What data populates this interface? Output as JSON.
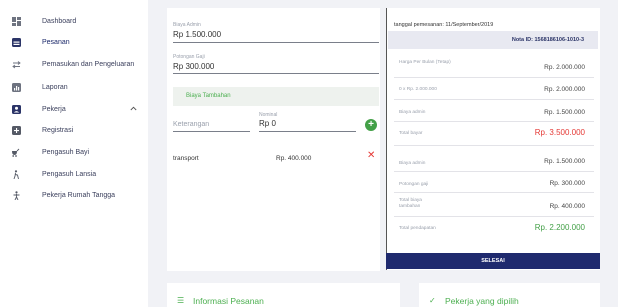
{
  "sidebar": {
    "items": [
      {
        "label": "Dashboard",
        "icon": "dashboard-icon"
      },
      {
        "label": "Pesanan",
        "icon": "orders-icon"
      },
      {
        "label": "Pemasukan dan Pengeluaran",
        "icon": "transfer-icon"
      },
      {
        "label": "Laporan",
        "icon": "report-icon"
      },
      {
        "label": "Pekerja",
        "icon": "worker-icon"
      },
      {
        "label": "Registrasi",
        "icon": "plus-box-icon"
      },
      {
        "label": "Pengasuh Bayi",
        "icon": "baby-icon"
      },
      {
        "label": "Pengasuh Lansia",
        "icon": "elderly-icon"
      },
      {
        "label": "Pekerja Rumah Tangga",
        "icon": "housekeeper-icon"
      }
    ]
  },
  "form": {
    "biaya_admin_label": "Biaya Admin",
    "biaya_admin_value": "Rp  1.500.000",
    "potongan_gaji_label": "Potongan Gaji",
    "potongan_gaji_value": "Rp  300.000",
    "biaya_tambahan_label": "Biaya Tambahan",
    "keterangan_placeholder": "Keterangan",
    "nominal_label": "Nominal",
    "nominal_value": "Rp  0",
    "rows": [
      {
        "keterangan": "transport",
        "nominal": "Rp. 400.000"
      }
    ]
  },
  "summary": {
    "tanggal": "tanggal pemesanan: 11/September/2019",
    "nota": "Nota ID: 1568186106-1010-3",
    "items": [
      {
        "label": "Harga Per Bulan (Tetap)",
        "value": "Rp. 2.000.000"
      },
      {
        "label": "0 x Rp. 2.000.000",
        "value": "Rp. 2.000.000"
      },
      {
        "label": "Biaya admin",
        "value": "Rp. 1.500.000"
      },
      {
        "label": "Total bayar",
        "value": "Rp. 3.500.000"
      },
      {
        "label": "Biaya admin",
        "value": "Rp. 1.500.000"
      },
      {
        "label": "Potongan gaji",
        "value": "Rp. 300.000"
      },
      {
        "label": "Total biaya tambahan",
        "value": "Rp. 400.000"
      },
      {
        "label": "Total pendapatan",
        "value": "Rp. 2.200.000"
      }
    ],
    "selesai_label": "SELESAI"
  },
  "bottom": {
    "informasi_title": "Informasi Pesanan",
    "pekerja_title": "Pekerja yang dipilih"
  },
  "colors": {
    "primary": "#1f2a6e",
    "green": "#43a047",
    "red": "#e53935"
  }
}
